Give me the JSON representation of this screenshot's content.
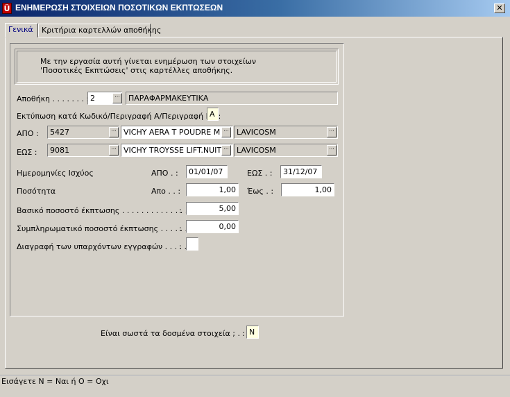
{
  "window": {
    "title": "ΕΝΗΜΕΡΩΣΗ ΣΤΟΙΧΕΙΩΝ ΠΟΣΟΤΙΚΩΝ ΕΚΠΤΩΣΕΩΝ",
    "app_icon_glyph": "Ü",
    "close_glyph": "✕"
  },
  "tabs": [
    {
      "label": "Γενικά",
      "active": true
    },
    {
      "label": "Κριτήρια καρτελλών αποθήκης",
      "active": false
    }
  ],
  "info": {
    "line1": "Με την εργασία αυτή γίνεται ενημέρωση των στοιχείων",
    "line2": " 'Ποσοτικές Εκπτώσεις' στις καρτέλλες αποθήκης."
  },
  "warehouse": {
    "label": "Αποθήκη . . . . . . .   :",
    "code": "2",
    "name": "ΠΑΡΑΦΑΡΜΑΚΕΥΤΙΚΑ"
  },
  "print_by": {
    "label": "Εκτύπωση κατά Κωδικό/Περιγραφή Α/Περιγραφή Β . :",
    "value": "A"
  },
  "from_row": {
    "label": "ΑΠΟ    :",
    "code": "5427",
    "description": "VICHY AERA T POUDRE M",
    "supplier": "LAVICOSM"
  },
  "to_row": {
    "label": "ΕΩΣ    :",
    "code": "9081",
    "description": "VICHY TROYSSE LIFT.NUIT",
    "supplier": "LAVICOSM"
  },
  "validity": {
    "label": "Ημερομηνίες Ισχύος",
    "from_label": "ΑΠΟ .    :",
    "from_value": "01/01/07",
    "to_label": "ΕΩΣ .    :",
    "to_value": "31/12/07"
  },
  "quantity": {
    "label": "Ποσότητα",
    "from_label": "Απο . .   :",
    "from_value": "1,00",
    "to_label": "Έως .    :",
    "to_value": "1,00"
  },
  "base_discount": {
    "label": "Βασικό ποσοστό έκπτωσης . . . . . . . . . . . . . . .",
    "colon": ":",
    "value": "5,00"
  },
  "extra_discount": {
    "label": "Συμπληρωματικό ποσοστό έκπτωσης . . . . . . .",
    "colon": ":",
    "value": "0,00"
  },
  "delete_existing": {
    "label": "Διαγραφή των υπαρχόντων εγγραφών . . . . .",
    "colon": ":",
    "value": ""
  },
  "confirm": {
    "label": "Είναι σωστά τα δοσμένα στοιχεία ; .",
    "colon": ":",
    "value": "N"
  },
  "lookup_glyph": "···",
  "status": {
    "text": "Εισάγετε N = Ναι  ή  O = Οχι"
  }
}
